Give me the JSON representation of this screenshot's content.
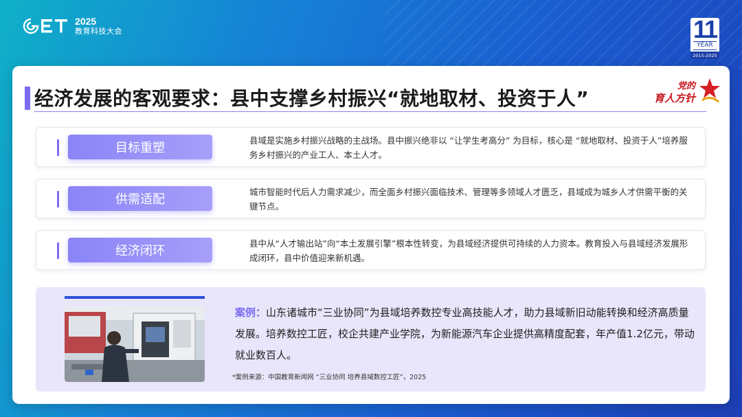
{
  "header": {
    "logo_year": "2025",
    "logo_subtitle": "教育科技大会",
    "badge": {
      "number": "11",
      "label": "YEAR",
      "range": "2015-2025"
    }
  },
  "slide": {
    "title": "经济发展的客观要求：县中支撑乡村振兴“就地取材、投资于人”",
    "emblem": {
      "line1": "党的",
      "line2": "育人方针"
    },
    "rows": [
      {
        "label": "目标重塑",
        "text": "县域是实施乡村振兴战略的主战场。县中振兴绝非以 “让学生考高分” 为目标，核心是 “就地取材、投资于人”培养服务乡村振兴的产业工人、本土人才。"
      },
      {
        "label": "供需适配",
        "text": "城市智能时代后人力需求减少，而全面乡村振兴面临技术、管理等多领域人才匮乏，县域成为城乡人才供需平衡的关键节点。"
      },
      {
        "label": "经济闭环",
        "text": "县中从“人才输出站”向“本土发展引擎”根本性转变，为县域经济提供可持续的人力资本。教育投入与县域经济发展形成闭环，县中价值迎来新机遇。"
      }
    ],
    "case": {
      "keyword": "案例",
      "separator": "：",
      "body": "山东诸城市“三业协同”为县域培养数控专业高技能人才，助力县域新旧动能转换和经济高质量发展。培养数控工匠，校企共建产业学院，为新能源汽车企业提供高精度配套，年产值1.2亿元，带动就业数百人。",
      "source": "*案例来源：中国教育新闻网 “三业协同 培养县域数控工匠”，2025"
    }
  },
  "colors": {
    "accent": "#7a6cf0",
    "label_gradient_start": "#8a84f7",
    "label_gradient_end": "#a79ff9",
    "case_bg": "#e9e6fb",
    "emblem_red": "#c8161d"
  }
}
